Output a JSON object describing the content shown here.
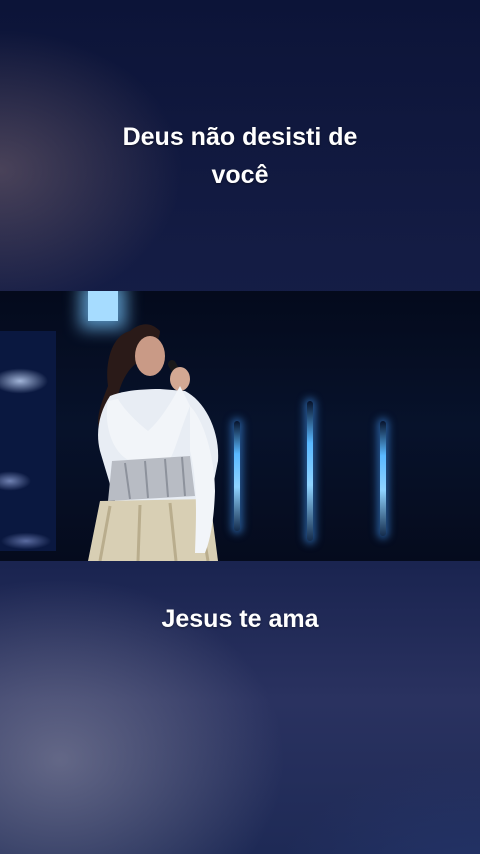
{
  "captions": {
    "top_line1": "Deus não desisti de",
    "top_line2": "você",
    "bottom": "Jesus te ama"
  },
  "video": {
    "content": "singer-performance"
  }
}
